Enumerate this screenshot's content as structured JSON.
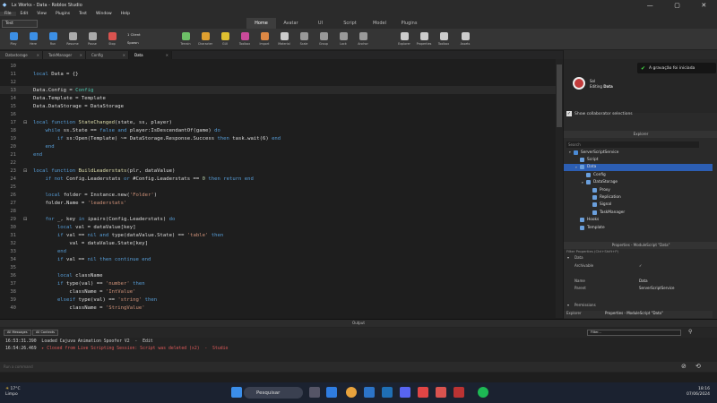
{
  "window": {
    "title": "Lx Works - Data - Roblox Studio"
  },
  "menu": [
    "File",
    "Edit",
    "View",
    "Plugins",
    "Test",
    "Window",
    "Help"
  ],
  "ribbon_tabs": {
    "selector": "Test",
    "tabs": [
      "Home",
      "Avatar",
      "UI",
      "Script",
      "Model",
      "Plugins"
    ]
  },
  "ribbon_buttons": [
    "Play",
    "Here",
    "Run",
    "Resume",
    "Pause",
    "Stop",
    "Client",
    "Server",
    "Players",
    "Spawn",
    "Part",
    "Terrain",
    "Character",
    "GUI",
    "Toolbox",
    "Import",
    "Material",
    "Scale",
    "Group",
    "Lock",
    "Anchor",
    "Explorer",
    "Properties",
    "Toolbox",
    "Assets"
  ],
  "ribbon_dropdowns": {
    "players": "1 Client",
    "spawn": "Spawn"
  },
  "doc_tabs": [
    "Datastorage",
    "TaskManager",
    "Config",
    "Data"
  ],
  "editor": {
    "lines": [
      {
        "n": "10",
        "fold": "",
        "parts": []
      },
      {
        "n": "11",
        "fold": "",
        "parts": [
          {
            "t": "local ",
            "c": "#569cd6"
          },
          {
            "t": "Data = {}",
            "c": "#dcdcdc"
          }
        ]
      },
      {
        "n": "12",
        "fold": "",
        "parts": []
      },
      {
        "n": "13",
        "fold": "",
        "hl": true,
        "parts": [
          {
            "t": "Data.Config = ",
            "c": "#dcdcdc"
          },
          {
            "t": "Config",
            "c": "#4ec9b0"
          }
        ]
      },
      {
        "n": "14",
        "fold": "",
        "parts": [
          {
            "t": "Data.Template = Template",
            "c": "#dcdcdc"
          }
        ]
      },
      {
        "n": "15",
        "fold": "",
        "parts": [
          {
            "t": "Data.DataStorage = DataStorage",
            "c": "#dcdcdc"
          }
        ]
      },
      {
        "n": "16",
        "fold": "",
        "parts": []
      },
      {
        "n": "17",
        "fold": "⊟",
        "parts": [
          {
            "t": "local function ",
            "c": "#569cd6"
          },
          {
            "t": "StateChanged",
            "c": "#dcdcaa"
          },
          {
            "t": "(state, ss, player)",
            "c": "#dcdcdc"
          }
        ]
      },
      {
        "n": "18",
        "fold": "",
        "parts": [
          {
            "t": "    while ",
            "c": "#569cd6"
          },
          {
            "t": "ss.State == ",
            "c": "#dcdcdc"
          },
          {
            "t": "false ",
            "c": "#569cd6"
          },
          {
            "t": "and ",
            "c": "#569cd6"
          },
          {
            "t": "player:IsDescendantOf(game) ",
            "c": "#dcdcdc"
          },
          {
            "t": "do",
            "c": "#569cd6"
          }
        ]
      },
      {
        "n": "19",
        "fold": "",
        "parts": [
          {
            "t": "        if ",
            "c": "#569cd6"
          },
          {
            "t": "ss:Open(Template) ~= DataStorage.Response.Success ",
            "c": "#dcdcdc"
          },
          {
            "t": "then ",
            "c": "#569cd6"
          },
          {
            "t": "task.wait(6) ",
            "c": "#dcdcdc"
          },
          {
            "t": "end",
            "c": "#569cd6"
          }
        ]
      },
      {
        "n": "20",
        "fold": "",
        "parts": [
          {
            "t": "    end",
            "c": "#569cd6"
          }
        ]
      },
      {
        "n": "21",
        "fold": "",
        "parts": [
          {
            "t": "end",
            "c": "#569cd6"
          }
        ]
      },
      {
        "n": "22",
        "fold": "",
        "parts": []
      },
      {
        "n": "23",
        "fold": "⊟",
        "parts": [
          {
            "t": "local function ",
            "c": "#569cd6"
          },
          {
            "t": "BuildLeaderstats",
            "c": "#dcdcaa"
          },
          {
            "t": "(plr, dataValue)",
            "c": "#dcdcdc"
          }
        ]
      },
      {
        "n": "24",
        "fold": "",
        "parts": [
          {
            "t": "    if not ",
            "c": "#569cd6"
          },
          {
            "t": "Config.Leaderstats ",
            "c": "#dcdcdc"
          },
          {
            "t": "or ",
            "c": "#569cd6"
          },
          {
            "t": "#Config.Leaderstats == ",
            "c": "#dcdcdc"
          },
          {
            "t": "0 ",
            "c": "#b5cea8"
          },
          {
            "t": "then return end",
            "c": "#569cd6"
          }
        ]
      },
      {
        "n": "25",
        "fold": "",
        "parts": []
      },
      {
        "n": "26",
        "fold": "",
        "parts": [
          {
            "t": "    local ",
            "c": "#569cd6"
          },
          {
            "t": "folder = Instance.new(",
            "c": "#dcdcdc"
          },
          {
            "t": "'Folder'",
            "c": "#ce9178"
          },
          {
            "t": ")",
            "c": "#dcdcdc"
          }
        ]
      },
      {
        "n": "27",
        "fold": "",
        "parts": [
          {
            "t": "    folder.Name = ",
            "c": "#dcdcdc"
          },
          {
            "t": "'leaderstats'",
            "c": "#ce9178"
          }
        ]
      },
      {
        "n": "28",
        "fold": "",
        "parts": []
      },
      {
        "n": "29",
        "fold": "⊟",
        "parts": [
          {
            "t": "    for ",
            "c": "#569cd6"
          },
          {
            "t": "_, key ",
            "c": "#dcdcdc"
          },
          {
            "t": "in ",
            "c": "#569cd6"
          },
          {
            "t": "ipairs(Config.Leaderstats) ",
            "c": "#dcdcdc"
          },
          {
            "t": "do",
            "c": "#569cd6"
          }
        ]
      },
      {
        "n": "30",
        "fold": "",
        "parts": [
          {
            "t": "        local ",
            "c": "#569cd6"
          },
          {
            "t": "val = dataValue[key]",
            "c": "#dcdcdc"
          }
        ]
      },
      {
        "n": "31",
        "fold": "",
        "parts": [
          {
            "t": "        if ",
            "c": "#569cd6"
          },
          {
            "t": "val == ",
            "c": "#dcdcdc"
          },
          {
            "t": "nil and ",
            "c": "#569cd6"
          },
          {
            "t": "type(dataValue.State) == ",
            "c": "#dcdcdc"
          },
          {
            "t": "'table' ",
            "c": "#ce9178"
          },
          {
            "t": "then",
            "c": "#569cd6"
          }
        ]
      },
      {
        "n": "32",
        "fold": "",
        "parts": [
          {
            "t": "            val = dataValue.State[key]",
            "c": "#dcdcdc"
          }
        ]
      },
      {
        "n": "33",
        "fold": "",
        "parts": [
          {
            "t": "        end",
            "c": "#569cd6"
          }
        ]
      },
      {
        "n": "34",
        "fold": "",
        "parts": [
          {
            "t": "        if ",
            "c": "#569cd6"
          },
          {
            "t": "val == ",
            "c": "#dcdcdc"
          },
          {
            "t": "nil then continue end",
            "c": "#569cd6"
          }
        ]
      },
      {
        "n": "35",
        "fold": "",
        "parts": []
      },
      {
        "n": "36",
        "fold": "",
        "parts": [
          {
            "t": "        local ",
            "c": "#569cd6"
          },
          {
            "t": "className",
            "c": "#dcdcdc"
          }
        ]
      },
      {
        "n": "37",
        "fold": "",
        "parts": [
          {
            "t": "        if ",
            "c": "#569cd6"
          },
          {
            "t": "type(val) == ",
            "c": "#dcdcdc"
          },
          {
            "t": "'number' ",
            "c": "#ce9178"
          },
          {
            "t": "then",
            "c": "#569cd6"
          }
        ]
      },
      {
        "n": "38",
        "fold": "",
        "parts": [
          {
            "t": "            className = ",
            "c": "#dcdcdc"
          },
          {
            "t": "'IntValue'",
            "c": "#ce9178"
          }
        ]
      },
      {
        "n": "39",
        "fold": "",
        "parts": [
          {
            "t": "        elseif ",
            "c": "#569cd6"
          },
          {
            "t": "type(val) == ",
            "c": "#dcdcdc"
          },
          {
            "t": "'string' ",
            "c": "#ce9178"
          },
          {
            "t": "then",
            "c": "#569cd6"
          }
        ]
      },
      {
        "n": "40",
        "fold": "",
        "parts": [
          {
            "t": "            className = ",
            "c": "#dcdcdc"
          },
          {
            "t": "'StringValue'",
            "c": "#ce9178"
          }
        ]
      }
    ]
  },
  "recording": {
    "user": "Sol",
    "editing_prefix": "Editing ",
    "editing_script": "Data",
    "message": "A gravação foi iniciada"
  },
  "collab": {
    "label": "Show collaborator selections",
    "checked": true
  },
  "explorer": {
    "title": "Explorer",
    "search_placeholder": "Search",
    "items": [
      {
        "label": "ServerScriptService",
        "depth": 0,
        "arrow": "▾",
        "color": "#4b8bd6"
      },
      {
        "label": "Script",
        "depth": 1,
        "arrow": "",
        "color": "#6a9fdc"
      },
      {
        "label": "Data",
        "depth": 1,
        "arrow": "▾",
        "color": "#6a9fdc",
        "selected": true
      },
      {
        "label": "Config",
        "depth": 2,
        "arrow": "",
        "color": "#6a9fdc"
      },
      {
        "label": "DataStorage",
        "depth": 2,
        "arrow": "▾",
        "color": "#6a9fdc"
      },
      {
        "label": "Proxy",
        "depth": 3,
        "arrow": "",
        "color": "#6a9fdc"
      },
      {
        "label": "Replication",
        "depth": 3,
        "arrow": "",
        "color": "#6a9fdc"
      },
      {
        "label": "Signal",
        "depth": 3,
        "arrow": "",
        "color": "#6a9fdc"
      },
      {
        "label": "TaskManager",
        "depth": 3,
        "arrow": "",
        "color": "#6a9fdc"
      },
      {
        "label": "Hooks",
        "depth": 1,
        "arrow": "",
        "color": "#6a9fdc"
      },
      {
        "label": "Template",
        "depth": 1,
        "arrow": "",
        "color": "#6a9fdc"
      }
    ]
  },
  "properties": {
    "title": "Properties - ModuleScript \"Data\"",
    "filter": "Filter Properties (Ctrl+Shift+P)",
    "section_data": "Data",
    "rows": [
      {
        "k": "Archivable",
        "v": "✓"
      },
      {
        "k": "Name",
        "v": "Data"
      },
      {
        "k": "Parent",
        "v": "ServerScriptService"
      }
    ],
    "section_permissions": "Permissions",
    "footer_left": "Explorer",
    "footer_right": "Properties - ModuleScript \"Data\""
  },
  "output": {
    "title": "Output",
    "filter_all_messages": "All Messages",
    "filter_all_contexts": "All Contexts",
    "filter_placeholder": "Filter...",
    "lines": [
      {
        "ts": "16:53:31.390",
        "text": "  Loaded Cajuva Animation Spoofer V2  -  Edit",
        "c": "#cfcfcf"
      },
      {
        "ts": "16:54:26.469",
        "text": "  ▸ Closed from Live Scripting Session: Script was deleted (x2)  -  Studio",
        "c": "#e05a5a"
      }
    ],
    "command_placeholder": "Run a command"
  },
  "taskbar": {
    "temp": "17°C",
    "weather": "Limpo",
    "search": "Pesquisar",
    "time": "18:16",
    "date": "07/06/2024"
  },
  "colors": {
    "accent": "#2c5eb3",
    "record": "#c23b3b"
  }
}
